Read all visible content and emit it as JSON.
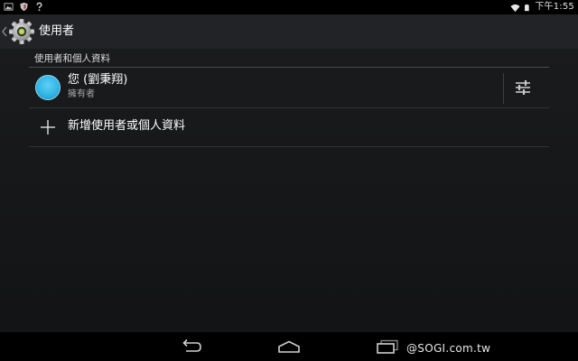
{
  "status_bar": {
    "time": "下午1:55",
    "left_icons": [
      "picture-icon",
      "shield-icon",
      "question-icon"
    ],
    "right_icons": [
      "wifi-icon",
      "battery-icon"
    ]
  },
  "action_bar": {
    "title": "使用者",
    "icon": "settings-gear-icon"
  },
  "section": {
    "header": "使用者和個人資料"
  },
  "users": [
    {
      "name": "您 (劉秉翔)",
      "role": "擁有者",
      "avatar_color": "#33b5e5"
    }
  ],
  "add_user": {
    "label": "新增使用者或個人資料"
  },
  "nav_bar": {
    "buttons": [
      "back-icon",
      "home-icon",
      "recent-apps-icon"
    ]
  },
  "watermark": "@SOGI.com.tw",
  "colors": {
    "accent": "#33b5e5",
    "background": "#1b1c1e",
    "action_bar": "#212326"
  }
}
